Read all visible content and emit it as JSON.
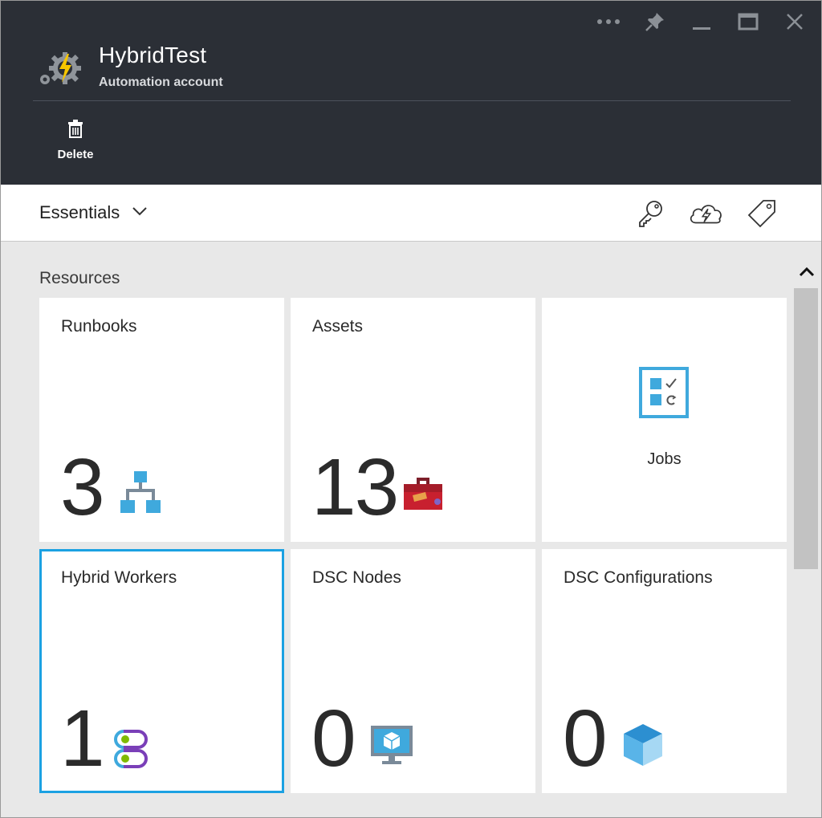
{
  "window": {
    "controls": [
      {
        "name": "more-options-icon"
      },
      {
        "name": "pin-icon"
      },
      {
        "name": "minimize-icon"
      },
      {
        "name": "maximize-icon"
      },
      {
        "name": "close-icon"
      }
    ]
  },
  "header": {
    "title": "HybridTest",
    "subtitle": "Automation account",
    "icon": "automation-gear-icon"
  },
  "commands": {
    "delete_label": "Delete"
  },
  "essentials": {
    "label": "Essentials",
    "icons": [
      "key-icon",
      "cloud-icon",
      "tag-icon"
    ]
  },
  "resources": {
    "heading": "Resources",
    "tiles": [
      {
        "label": "Runbooks",
        "count": "3",
        "icon": "runbook-hierarchy-icon"
      },
      {
        "label": "Assets",
        "count": "13",
        "icon": "toolbox-icon"
      },
      {
        "label": "Jobs",
        "icon": "jobs-checklist-icon"
      },
      {
        "label": "Hybrid Workers",
        "count": "1",
        "icon": "hybrid-worker-icon",
        "selected": true
      },
      {
        "label": "DSC Nodes",
        "count": "0",
        "icon": "dsc-node-monitor-icon"
      },
      {
        "label": "DSC Configurations",
        "count": "0",
        "icon": "dsc-configuration-cube-icon"
      }
    ]
  },
  "colors": {
    "header_bg": "#2b2f36",
    "accent": "#1ba1e2",
    "content_bg": "#e8e8e8"
  }
}
